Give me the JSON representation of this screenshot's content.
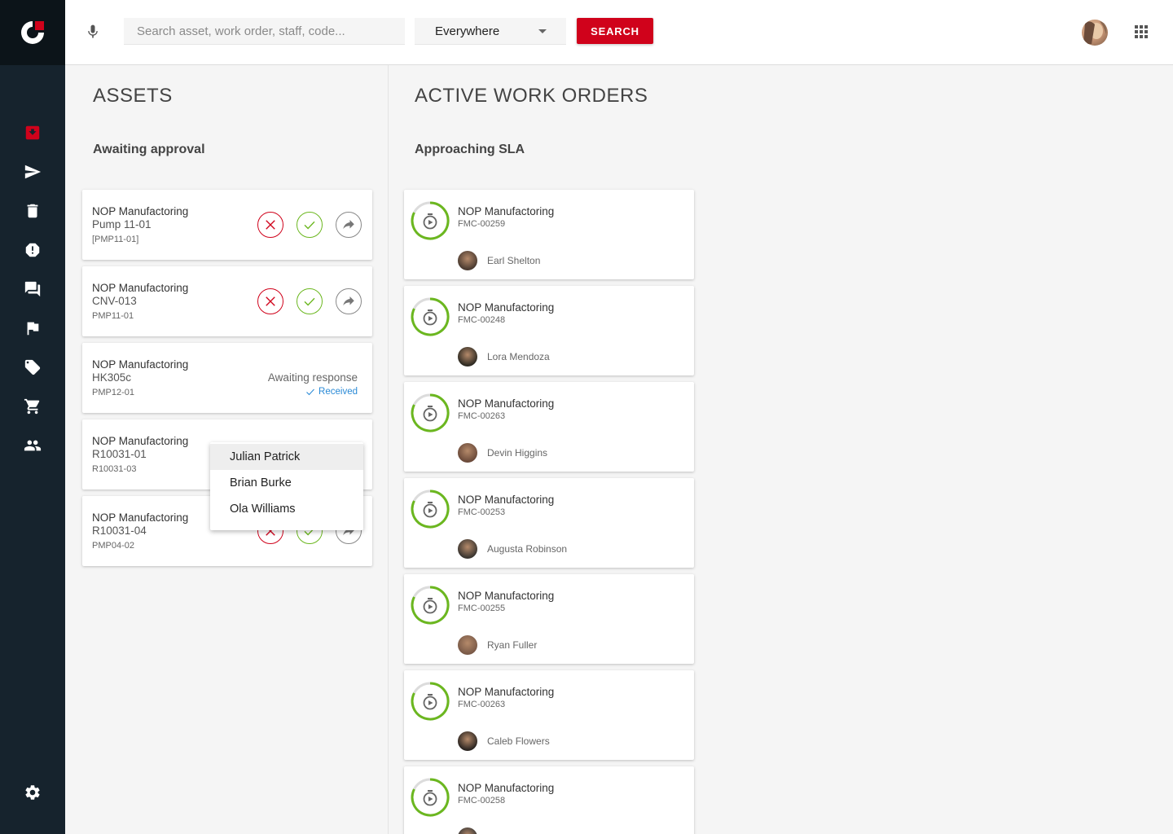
{
  "header": {
    "search_placeholder": "Search asset, work order, staff, code...",
    "scope": "Everywhere",
    "search_label": "SEARCH"
  },
  "assets": {
    "title": "ASSETS",
    "subtitle": "Awaiting approval",
    "cards": [
      {
        "company": "NOP Manufactoring",
        "name": "Pump 11-01",
        "code": "[PMP11-01]"
      },
      {
        "company": "NOP Manufactoring",
        "name": "CNV-013",
        "code": "PMP11-01"
      },
      {
        "company": "NOP Manufactoring",
        "name": "HK305c",
        "code": "PMP12-01",
        "status": "Awaiting response",
        "status_sub": "Received"
      },
      {
        "company": "NOP Manufactoring",
        "name": "R10031-01",
        "code": "R10031-03"
      },
      {
        "company": "NOP Manufactoring",
        "name": "R10031-04",
        "code": "PMP04-02"
      }
    ],
    "dropdown_options": [
      "Julian Patrick",
      "Brian Burke",
      "Ola Williams"
    ]
  },
  "work_orders": {
    "title": "ACTIVE WORK ORDERS",
    "subtitle": "Approaching SLA",
    "cards": [
      {
        "company": "NOP Manufactoring",
        "code": "FMC-00259",
        "assignee": "Earl Shelton"
      },
      {
        "company": "NOP Manufactoring",
        "code": "FMC-00248",
        "assignee": "Lora Mendoza"
      },
      {
        "company": "NOP Manufactoring",
        "code": "FMC-00263",
        "assignee": "Devin Higgins"
      },
      {
        "company": "NOP Manufactoring",
        "code": "FMC-00253",
        "assignee": "Augusta Robinson"
      },
      {
        "company": "NOP Manufactoring",
        "code": "FMC-00255",
        "assignee": "Ryan Fuller"
      },
      {
        "company": "NOP Manufactoring",
        "code": "FMC-00263",
        "assignee": "Caleb Flowers"
      },
      {
        "company": "NOP Manufactoring",
        "code": "FMC-00258",
        "assignee": ""
      }
    ]
  },
  "sidebar": {
    "items": [
      "inbox-icon",
      "send-icon",
      "trash-icon",
      "alert-icon",
      "chat-icon",
      "flag-icon",
      "tag-icon",
      "cart-icon",
      "people-icon",
      "settings-icon"
    ],
    "active_item": "inbox-icon"
  },
  "colors": {
    "brand_red": "#d0021b",
    "approve_green": "#6bb71f",
    "sidebar_bg": "#16232d",
    "link_blue": "#2a8ad6"
  }
}
